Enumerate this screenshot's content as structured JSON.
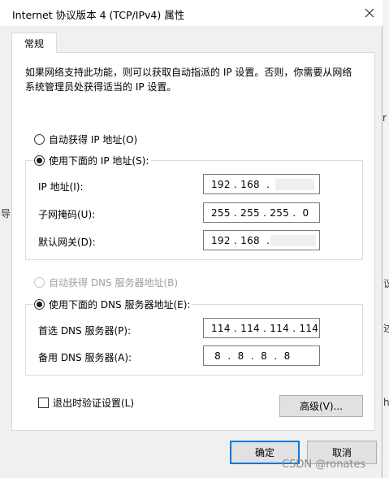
{
  "window": {
    "title": "Internet 协议版本 4 (TCP/IPv4) 属性"
  },
  "tabs": [
    {
      "label": "常规",
      "active": true
    }
  ],
  "description": "如果网络支持此功能，则可以获取自动指派的 IP 设置。否则，你需要从网络系统管理员处获得适当的 IP 设置。",
  "ip_section": {
    "auto_label": "自动获得 IP 地址(O)",
    "auto_selected": false,
    "manual_label": "使用下面的 IP 地址(S):",
    "manual_selected": true,
    "fields": [
      {
        "label": "IP 地址(I):",
        "value": "192 . 168  .",
        "obscured": true
      },
      {
        "label": "子网掩码(U):",
        "value": "255 . 255 . 255 .  0",
        "obscured": false
      },
      {
        "label": "默认网关(D):",
        "value": "192 . 168  .",
        "obscured": true
      }
    ]
  },
  "dns_section": {
    "auto_label": "自动获得 DNS 服务器地址(B)",
    "auto_selected": false,
    "auto_disabled": true,
    "manual_label": "使用下面的 DNS 服务器地址(E):",
    "manual_selected": true,
    "fields": [
      {
        "label": "首选 DNS 服务器(P):",
        "value": "114 . 114 . 114 . 114"
      },
      {
        "label": "备用 DNS 服务器(A):",
        "value": " 8  .  8  .  8  .  8"
      }
    ]
  },
  "validate_on_exit": {
    "label": "退出时验证设置(L)",
    "checked": false
  },
  "buttons": {
    "advanced": "高级(V)...",
    "ok": "确定",
    "cancel": "取消"
  },
  "background": {
    "glyphs": [
      "r",
      "d",
      "导",
      "议",
      "述",
      "h"
    ]
  },
  "watermark": "CSDN @ronates",
  "colors": {
    "accent": "#0078d7",
    "dialog_bg": "#f0f0f0",
    "panel_bg": "#ffffff",
    "disabled_text": "#a0a0a0"
  }
}
